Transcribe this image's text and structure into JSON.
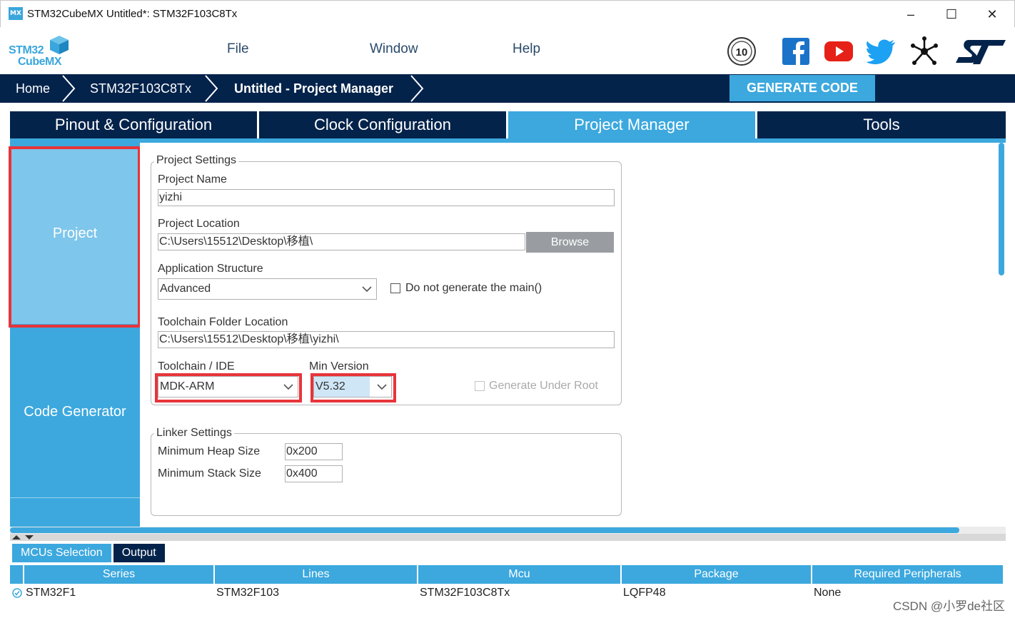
{
  "window": {
    "icon_label": "MX",
    "title": "STM32CubeMX Untitled*: STM32F103C8Tx",
    "controls": [
      "–",
      "☐",
      "✕"
    ]
  },
  "logo": {
    "line1": "STM32",
    "line2": "CubeMX"
  },
  "menu": {
    "file": "File",
    "window": "Window",
    "help": "Help"
  },
  "social": {
    "anniversary": "10"
  },
  "breadcrumb": {
    "home": "Home",
    "mcu": "STM32F103C8Tx",
    "current": "Untitled - Project Manager"
  },
  "generate_button": "GENERATE CODE",
  "tabs": [
    {
      "label": "Pinout & Configuration"
    },
    {
      "label": "Clock Configuration"
    },
    {
      "label": "Project Manager"
    },
    {
      "label": "Tools"
    }
  ],
  "left_nav": {
    "project": "Project",
    "code_generator": "Code Generator"
  },
  "project_settings": {
    "legend": "Project Settings",
    "project_name_label": "Project Name",
    "project_name": "yizhi",
    "project_location_label": "Project Location",
    "project_location": "C:\\Users\\15512\\Desktop\\移植\\",
    "browse_label": "Browse",
    "app_structure_label": "Application Structure",
    "app_structure": "Advanced",
    "no_main_label": "Do not generate the main()",
    "toolchain_folder_label": "Toolchain Folder Location",
    "toolchain_folder": "C:\\Users\\15512\\Desktop\\移植\\yizhi\\",
    "toolchain_label": "Toolchain / IDE",
    "toolchain": "MDK-ARM",
    "min_version_label": "Min Version",
    "min_version": "V5.32",
    "gen_under_root_label": "Generate Under Root"
  },
  "linker_settings": {
    "legend": "Linker Settings",
    "heap_label": "Minimum Heap Size",
    "heap": "0x200",
    "stack_label": "Minimum Stack Size",
    "stack": "0x400"
  },
  "bottom_tabs": {
    "mcus": "MCUs Selection",
    "output": "Output"
  },
  "table": {
    "headers": [
      "Series",
      "Lines",
      "Mcu",
      "Package",
      "Required Peripherals"
    ],
    "rows": [
      [
        "STM32F1",
        "STM32F103",
        "STM32F103C8Tx",
        "LQFP48",
        "None"
      ]
    ]
  },
  "watermark": "CSDN @小罗de社区",
  "colors": {
    "navy": "#03234b",
    "accent": "#3ca8de",
    "light_accent": "#7ec6eb",
    "highlight": "#e8343a"
  }
}
